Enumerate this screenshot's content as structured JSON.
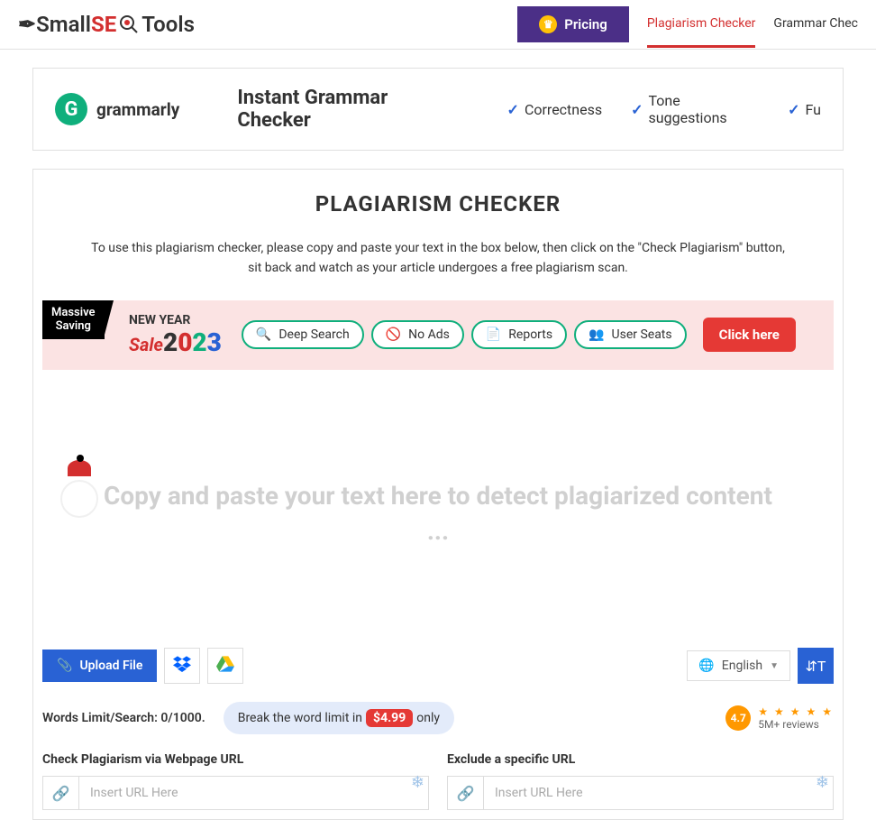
{
  "header": {
    "logo_small": "Small",
    "logo_seo": "SE",
    "logo_tools": "Tools",
    "pricing": "Pricing",
    "nav": {
      "plagiarism": "Plagiarism Checker",
      "grammar": "Grammar Chec"
    }
  },
  "ad": {
    "grammarly": "grammarly",
    "headline": "Instant Grammar Checker",
    "feature1": "Correctness",
    "feature2": "Tone suggestions",
    "feature3": "Fu"
  },
  "page": {
    "title": "PLAGIARISM CHECKER",
    "instruction": "To use this plagiarism checker, please copy and paste your text in the box below, then click on the \"Check Plagiarism\" button, sit back and watch as your article undergoes a free plagiarism scan."
  },
  "promo": {
    "massive": "Massive",
    "saving": "Saving",
    "new_year": "NEW YEAR",
    "sale": "Sale",
    "pill1": "Deep Search",
    "pill2": "No Ads",
    "pill3": "Reports",
    "pill4": "User Seats",
    "click_here": "Click here"
  },
  "editor": {
    "placeholder": "Copy and paste your text here to detect plagiarized content ..."
  },
  "toolbar": {
    "upload": "Upload File",
    "language": "English"
  },
  "limit": {
    "words": "Words Limit/Search: 0/1000.",
    "break_text_pre": "Break the word limit in",
    "price": "$4.99",
    "break_text_post": "only"
  },
  "rating": {
    "score": "4.7",
    "reviews": "5M+ reviews"
  },
  "urls": {
    "check_label": "Check Plagiarism via Webpage URL",
    "exclude_label": "Exclude a specific URL",
    "placeholder": "Insert URL Here"
  }
}
